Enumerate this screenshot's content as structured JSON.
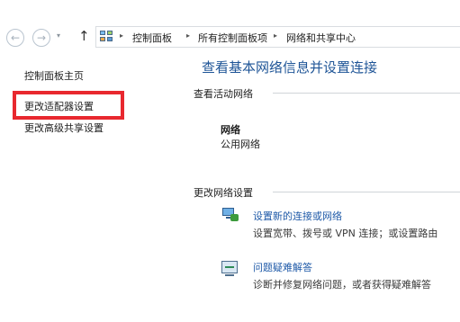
{
  "address_bar": {
    "back_glyph": "←",
    "forward_glyph": "→",
    "dropdown_glyph": "▾",
    "up_glyph": "↑",
    "separator": "▸",
    "breadcrumbs": [
      "控制面板",
      "所有控制面板项",
      "网络和共享中心"
    ]
  },
  "sidebar": {
    "home_label": "控制面板主页",
    "adapter_settings_label": "更改适配器设置",
    "advanced_sharing_label": "更改高级共享设置",
    "highlight_color": "#e8282f"
  },
  "main": {
    "title": "查看基本网络信息并设置连接",
    "active_networks_heading": "查看活动网络",
    "network": {
      "name": "网络",
      "type": "公用网络"
    },
    "change_settings_heading": "更改网络设置",
    "tasks": [
      {
        "icon": "network-setup-icon",
        "label": "设置新的连接或网络",
        "description": "设置宽带、拨号或 VPN 连接；或设置路由"
      },
      {
        "icon": "troubleshoot-icon",
        "label": "问题疑难解答",
        "description": "诊断并修复网络问题，或者获得疑难解答"
      }
    ]
  },
  "colors": {
    "link": "#1f5aa8",
    "title": "#1f5597"
  }
}
